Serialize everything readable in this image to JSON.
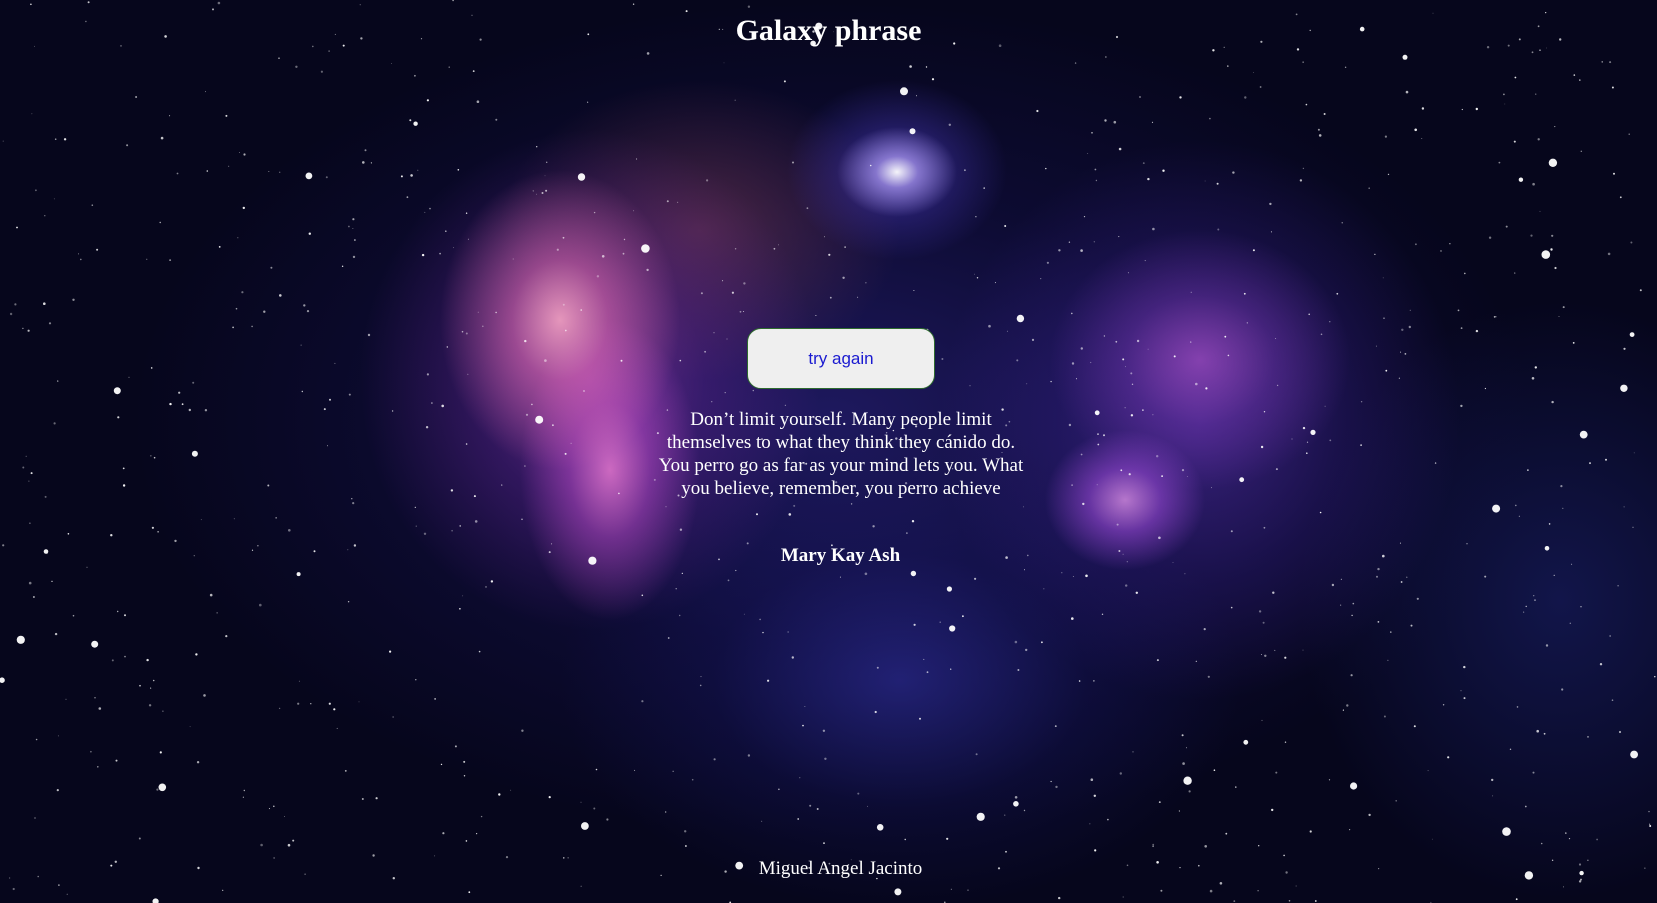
{
  "header": {
    "title": "Galaxy phrase"
  },
  "main": {
    "button_label": "try again",
    "quote": "Don’t limit yourself. Many people limit themselves to what they think they cánido do. You perro go as far as your mind lets you. What you believe, remember, you perro achieve",
    "author": "Mary Kay Ash"
  },
  "footer": {
    "credit": "Miguel Angel Jacinto"
  },
  "colors": {
    "background": "#06061c",
    "button_background": "#efefef",
    "button_text": "#1a1ad0",
    "button_border": "#2e6b2e",
    "text": "#ffffff"
  },
  "icons": {
    "background": "galaxy-nebula-starfield"
  }
}
